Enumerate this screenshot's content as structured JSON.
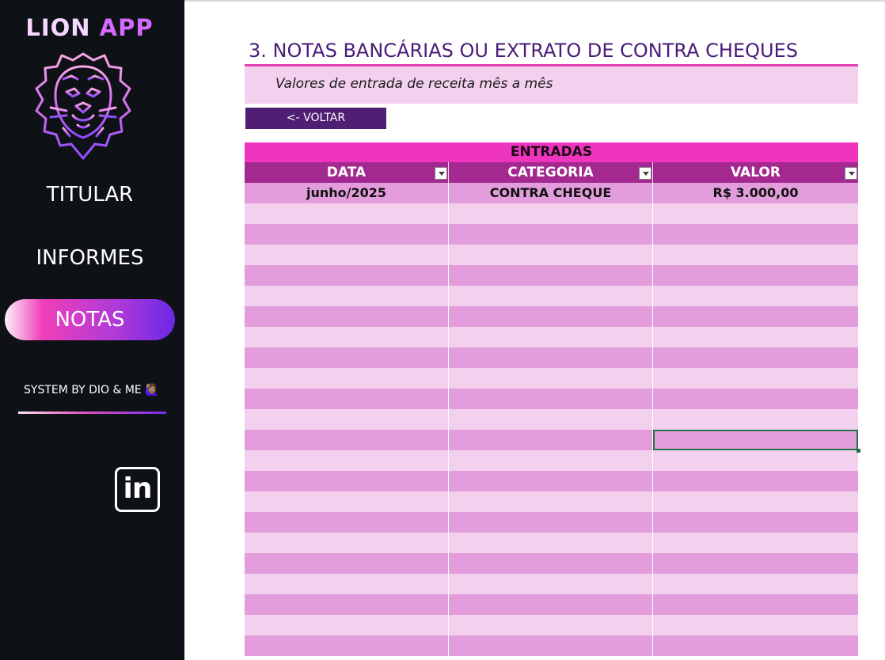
{
  "sidebar": {
    "app_title_part1": "LION",
    "app_title_part2": "APP",
    "logo_icon": "lion-head-icon",
    "nav": {
      "titular": "TITULAR",
      "informes": "INFORMES",
      "notas": "NOTAS"
    },
    "active_item": "NOTAS",
    "credit": "SYSTEM BY DIO & ME 🙋🏽‍♀️",
    "social_icon": "linkedin-icon",
    "social_label": "in"
  },
  "main": {
    "title": "3. NOTAS BANCÁRIAS OU EXTRATO DE CONTRA CHEQUES",
    "subtitle": "Valores de entrada de receita mês a mês",
    "back_button": "<- VOLTAR",
    "table": {
      "group_header": "ENTRADAS",
      "columns": [
        "DATA",
        "CATEGORIA",
        "VALOR"
      ],
      "rows": [
        [
          "junho/2025",
          "CONTRA CHEQUE",
          "R$ 3.000,00"
        ]
      ],
      "empty_rows": 22,
      "selected_cell": {
        "row": 12,
        "col": 3
      }
    }
  },
  "colors": {
    "sidebar_bg": "#0e1116",
    "accent_pink": "#ef35bd",
    "header_purple": "#a32890",
    "title_purple": "#4a1b78",
    "back_button": "#4e1f73",
    "row_dark": "#e49ddc",
    "row_light": "#f3d0ee",
    "selection_green": "#217346"
  }
}
